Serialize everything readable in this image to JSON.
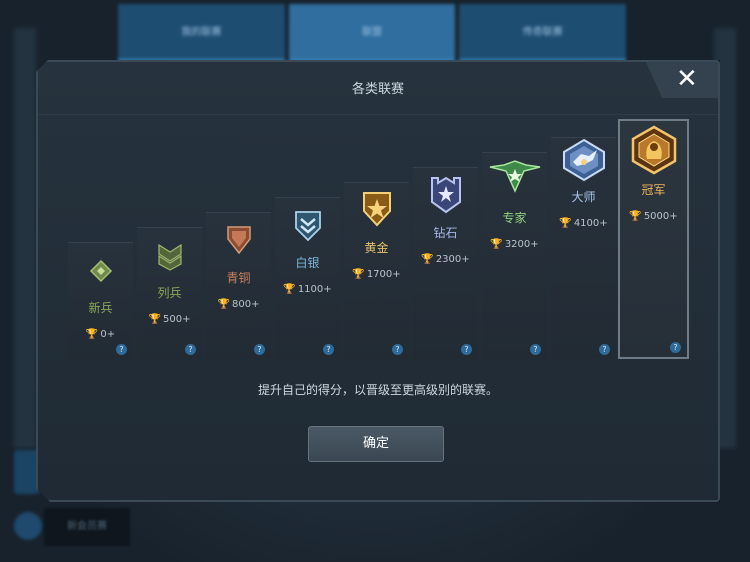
{
  "background": {
    "tabs": [
      "我的联赛",
      "联盟",
      "传奇联赛"
    ],
    "bottom_button": "新会员赛"
  },
  "modal": {
    "title": "各类联赛",
    "close_glyph": "✕",
    "hint": "提升自己的得分，以晋级至更高级别的联赛。",
    "confirm_label": "确定"
  },
  "leagues": [
    {
      "name": "新兵",
      "score": "0+",
      "color": "#8ba858",
      "icon": "recruit-icon"
    },
    {
      "name": "列兵",
      "score": "500+",
      "color": "#8ba858",
      "icon": "private-icon"
    },
    {
      "name": "青铜",
      "score": "800+",
      "color": "#c87f5c",
      "icon": "bronze-icon"
    },
    {
      "name": "白银",
      "score": "1100+",
      "color": "#7fb7da",
      "icon": "silver-icon"
    },
    {
      "name": "黄金",
      "score": "1700+",
      "color": "#e8c06a",
      "icon": "gold-icon"
    },
    {
      "name": "钻石",
      "score": "2300+",
      "color": "#a8b7e6",
      "icon": "diamond-icon"
    },
    {
      "name": "专家",
      "score": "3200+",
      "color": "#8fd27f",
      "icon": "expert-icon"
    },
    {
      "name": "大师",
      "score": "4100+",
      "color": "#a9c6ee",
      "icon": "master-icon"
    },
    {
      "name": "冠军",
      "score": "5000+",
      "color": "#f0b45a",
      "icon": "champion-icon"
    }
  ],
  "help_glyph": "?",
  "trophy_glyph": "🏆"
}
